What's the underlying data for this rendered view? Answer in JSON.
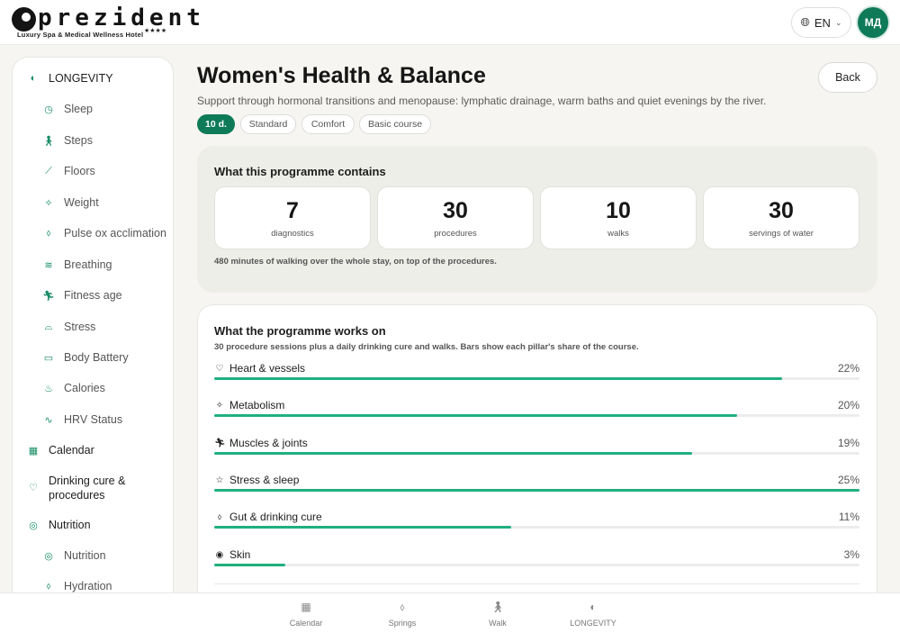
{
  "brand": {
    "name": "prezident",
    "tagline": "Luxury Spa & Medical Wellness Hotel",
    "stars": "★★★★"
  },
  "header": {
    "language": "EN",
    "avatar_initials": "МД"
  },
  "sidebar": {
    "items": [
      {
        "label": "LONGEVITY",
        "icon": "longevity-icon",
        "level": "top"
      },
      {
        "label": "Sleep",
        "icon": "clock-icon",
        "level": "sub"
      },
      {
        "label": "Steps",
        "icon": "walk-icon",
        "level": "sub"
      },
      {
        "label": "Floors",
        "icon": "stairs-icon",
        "level": "sub"
      },
      {
        "label": "Weight",
        "icon": "weight-icon",
        "level": "sub"
      },
      {
        "label": "Pulse ox acclimation",
        "icon": "drop-icon",
        "level": "sub"
      },
      {
        "label": "Breathing",
        "icon": "wind-icon",
        "level": "sub"
      },
      {
        "label": "Fitness age",
        "icon": "run-icon",
        "level": "sub"
      },
      {
        "label": "Stress",
        "icon": "gauge-icon",
        "level": "sub"
      },
      {
        "label": "Body Battery",
        "icon": "battery-icon",
        "level": "sub"
      },
      {
        "label": "Calories",
        "icon": "flame-icon",
        "level": "sub"
      },
      {
        "label": "HRV Status",
        "icon": "pulse-icon",
        "level": "sub"
      },
      {
        "label": "Calendar",
        "icon": "calendar-icon",
        "level": "top"
      },
      {
        "label": "Drinking cure & procedures",
        "icon": "heart-icon",
        "level": "top"
      },
      {
        "label": "Nutrition",
        "icon": "target-icon",
        "level": "top"
      },
      {
        "label": "Nutrition",
        "icon": "target-icon",
        "level": "sub"
      },
      {
        "label": "Hydration",
        "icon": "drop-icon",
        "level": "sub"
      }
    ]
  },
  "main": {
    "title": "Women's Health & Balance",
    "subtitle": "Support through hormonal transitions and menopause: lymphatic drainage, warm baths and quiet evenings by the river.",
    "back_label": "Back",
    "chips": [
      "10 d.",
      "Standard",
      "Comfort",
      "Basic course"
    ],
    "contains": {
      "heading": "What this programme contains",
      "stats": [
        {
          "value": "7",
          "label": "diagnostics"
        },
        {
          "value": "30",
          "label": "procedures"
        },
        {
          "value": "10",
          "label": "walks"
        },
        {
          "value": "30",
          "label": "servings of water"
        }
      ],
      "note": "480 minutes of walking over the whole stay, on top of the procedures."
    },
    "works_on": {
      "heading": "What the programme works on",
      "subtitle": "30 procedure sessions plus a daily drinking cure and walks. Bars show each pillar's share of the course.",
      "pillars": [
        {
          "name": "Heart & vessels",
          "pct": "22%",
          "fill": 0.88,
          "icon": "heart-icon"
        },
        {
          "name": "Metabolism",
          "pct": "20%",
          "fill": 0.81,
          "icon": "sparkle-icon"
        },
        {
          "name": "Muscles & joints",
          "pct": "19%",
          "fill": 0.74,
          "icon": "run-icon"
        },
        {
          "name": "Stress & sleep",
          "pct": "25%",
          "fill": 1.0,
          "icon": "star-icon"
        },
        {
          "name": "Gut & drinking cure",
          "pct": "11%",
          "fill": 0.46,
          "icon": "drop-icon"
        },
        {
          "name": "Skin",
          "pct": "3%",
          "fill": 0.11,
          "icon": "eye-icon"
        }
      ]
    }
  },
  "bottom_nav": [
    {
      "label": "Calendar",
      "icon": "calendar-icon"
    },
    {
      "label": "Springs",
      "icon": "drop-icon"
    },
    {
      "label": "Walk",
      "icon": "walk-icon"
    },
    {
      "label": "LONGEVITY",
      "icon": "longevity-icon"
    }
  ],
  "colors": {
    "accent": "#0f7a58",
    "bar": "#1fb07d"
  }
}
